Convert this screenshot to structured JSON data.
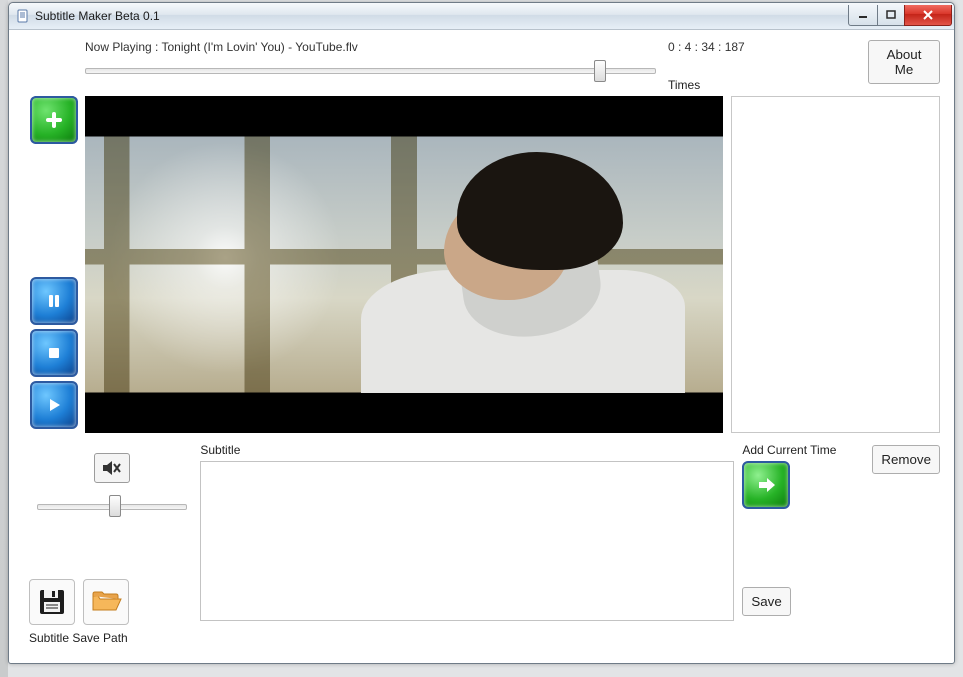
{
  "window": {
    "title": "Subtitle Maker Beta 0.1"
  },
  "now_playing": "Now Playing : Tonight (I'm Lovin' You) - YouTube.flv",
  "timecode": "0 : 4 : 34 : 187",
  "labels": {
    "times": "Times",
    "about": "About Me",
    "subtitle": "Subtitle",
    "add_current_time": "Add Current Time",
    "remove": "Remove",
    "save": "Save",
    "subtitle_save_path": "Subtitle Save Path"
  },
  "seek": {
    "percent": 90
  },
  "volume": {
    "percent": 50
  },
  "subtitle_text": "",
  "times_list": []
}
